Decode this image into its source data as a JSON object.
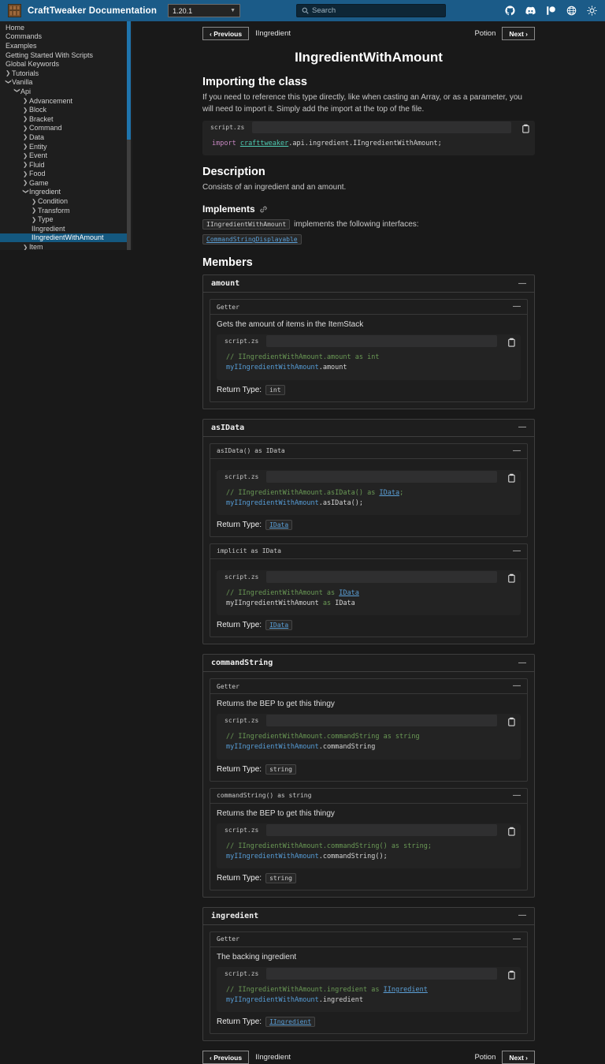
{
  "header": {
    "title": "CraftTweaker Documentation",
    "version": "1.20.1",
    "search_placeholder": "Search",
    "icons": [
      "github-icon",
      "discord-icon",
      "patreon-icon",
      "globe-icon",
      "theme-toggle-icon"
    ]
  },
  "sidebar": {
    "items": [
      {
        "label": "Home",
        "indent": 0,
        "arrow": "none",
        "selected": false
      },
      {
        "label": "Commands",
        "indent": 0,
        "arrow": "none",
        "selected": false
      },
      {
        "label": "Examples",
        "indent": 0,
        "arrow": "none",
        "selected": false
      },
      {
        "label": "Getting Started With Scripts",
        "indent": 0,
        "arrow": "none",
        "selected": false
      },
      {
        "label": "Global Keywords",
        "indent": 0,
        "arrow": "none",
        "selected": false
      },
      {
        "label": "Tutorials",
        "indent": 0,
        "arrow": "right",
        "selected": false
      },
      {
        "label": "Vanilla",
        "indent": 0,
        "arrow": "down",
        "selected": false
      },
      {
        "label": "Api",
        "indent": 1,
        "arrow": "down",
        "selected": false
      },
      {
        "label": "Advancement",
        "indent": 2,
        "arrow": "right",
        "selected": false
      },
      {
        "label": "Block",
        "indent": 2,
        "arrow": "right",
        "selected": false
      },
      {
        "label": "Bracket",
        "indent": 2,
        "arrow": "right",
        "selected": false
      },
      {
        "label": "Command",
        "indent": 2,
        "arrow": "right",
        "selected": false
      },
      {
        "label": "Data",
        "indent": 2,
        "arrow": "right",
        "selected": false
      },
      {
        "label": "Entity",
        "indent": 2,
        "arrow": "right",
        "selected": false
      },
      {
        "label": "Event",
        "indent": 2,
        "arrow": "right",
        "selected": false
      },
      {
        "label": "Fluid",
        "indent": 2,
        "arrow": "right",
        "selected": false
      },
      {
        "label": "Food",
        "indent": 2,
        "arrow": "right",
        "selected": false
      },
      {
        "label": "Game",
        "indent": 2,
        "arrow": "right",
        "selected": false
      },
      {
        "label": "Ingredient",
        "indent": 2,
        "arrow": "down",
        "selected": false
      },
      {
        "label": "Condition",
        "indent": 3,
        "arrow": "right",
        "selected": false
      },
      {
        "label": "Transform",
        "indent": 3,
        "arrow": "right",
        "selected": false
      },
      {
        "label": "Type",
        "indent": 3,
        "arrow": "right",
        "selected": false
      },
      {
        "label": "IIngredient",
        "indent": 3,
        "arrow": "none",
        "selected": false
      },
      {
        "label": "IIngredientWithAmount",
        "indent": 3,
        "arrow": "none",
        "selected": true
      },
      {
        "label": "Item",
        "indent": 2,
        "arrow": "right",
        "selected": false
      }
    ]
  },
  "pagenav": {
    "prev_button": "‹ Previous",
    "prev_label": "IIngredient",
    "next_label": "Potion",
    "next_button": "Next ›"
  },
  "page": {
    "title": "IIngredientWithAmount",
    "importing_heading": "Importing the class",
    "importing_body": "If you need to reference this type directly, like when casting an Array, or as a parameter, you will need to import it. Simply add the import at the top of the file.",
    "code_tab": "script.zs",
    "import_code": [
      [
        {
          "t": "import ",
          "s": "kw"
        },
        {
          "t": "crafttweaker",
          "s": "teal"
        },
        {
          "t": ".api.ingredient.IIngredientWithAmount;",
          "s": "plain"
        }
      ]
    ],
    "description_heading": "Description",
    "description_body": "Consists of an ingredient and an amount.",
    "implements_heading": "Implements",
    "implements_class": "IIngredientWithAmount",
    "implements_text": "implements the following interfaces:",
    "implements_interfaces": [
      "CommandStringDisplayable"
    ],
    "members_heading": "Members"
  },
  "members": [
    {
      "name": "amount",
      "groups": [
        {
          "title": "Getter",
          "description": "Gets the amount of items in the ItemStack",
          "code": [
            [
              {
                "t": "// IIngredientWithAmount.amount as int",
                "s": "comment"
              }
            ],
            [
              {
                "t": "myIIngredientWithAmount",
                "s": "blue"
              },
              {
                "t": ".amount",
                "s": "plain"
              }
            ]
          ],
          "return_label": "Return Type:",
          "return_type": "int",
          "return_link": false
        }
      ]
    },
    {
      "name": "asIData",
      "groups": [
        {
          "title": "asIData() as IData",
          "description": null,
          "code": [
            [
              {
                "t": "// IIngredientWithAmount.asIData() as ",
                "s": "comment"
              },
              {
                "t": "IData",
                "s": "comment-link"
              },
              {
                "t": ";",
                "s": "comment"
              }
            ],
            [
              {
                "t": "myIIngredientWithAmount",
                "s": "blue"
              },
              {
                "t": ".asIData();",
                "s": "plain"
              }
            ]
          ],
          "return_label": "Return Type:",
          "return_type": "IData",
          "return_link": true
        },
        {
          "title": "implicit as IData",
          "description": null,
          "code": [
            [
              {
                "t": "// IIngredientWithAmount as ",
                "s": "comment"
              },
              {
                "t": "IData",
                "s": "comment-link"
              }
            ],
            [
              {
                "t": "myIIngredientWithAmount ",
                "s": "plain"
              },
              {
                "t": "as",
                "s": "green"
              },
              {
                "t": " IData",
                "s": "plain"
              }
            ]
          ],
          "return_label": "Return Type:",
          "return_type": "IData",
          "return_link": true
        }
      ]
    },
    {
      "name": "commandString",
      "groups": [
        {
          "title": "Getter",
          "description": "Returns the BEP to get this thingy",
          "code": [
            [
              {
                "t": "// IIngredientWithAmount.commandString as string",
                "s": "comment"
              }
            ],
            [
              {
                "t": "myIIngredientWithAmount",
                "s": "blue"
              },
              {
                "t": ".commandString",
                "s": "plain"
              }
            ]
          ],
          "return_label": "Return Type:",
          "return_type": "string",
          "return_link": false
        },
        {
          "title": "commandString() as string",
          "description": "Returns the BEP to get this thingy",
          "code": [
            [
              {
                "t": "// IIngredientWithAmount.commandString() as string;",
                "s": "comment"
              }
            ],
            [
              {
                "t": "myIIngredientWithAmount",
                "s": "blue"
              },
              {
                "t": ".commandString();",
                "s": "plain"
              }
            ]
          ],
          "return_label": "Return Type:",
          "return_type": "string",
          "return_link": false
        }
      ]
    },
    {
      "name": "ingredient",
      "groups": [
        {
          "title": "Getter",
          "description": "The backing ingredient",
          "code": [
            [
              {
                "t": "// IIngredientWithAmount.ingredient as ",
                "s": "comment"
              },
              {
                "t": "IIngredient",
                "s": "comment-link"
              }
            ],
            [
              {
                "t": "myIIngredientWithAmount",
                "s": "blue"
              },
              {
                "t": ".ingredient",
                "s": "plain"
              }
            ]
          ],
          "return_label": "Return Type:",
          "return_type": "IIngredient",
          "return_link": true
        }
      ]
    }
  ]
}
